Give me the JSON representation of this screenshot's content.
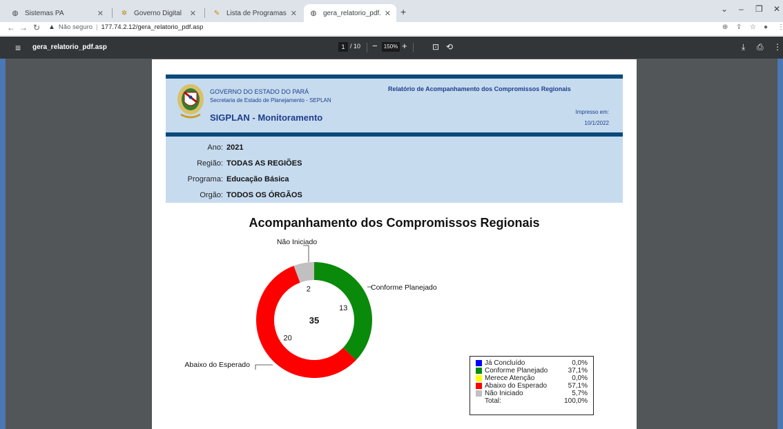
{
  "browser": {
    "tabs": [
      {
        "label": "Sistemas PA",
        "icon": "globe-icon",
        "active": false
      },
      {
        "label": "Governo Digital",
        "icon": "governo-icon",
        "active": false
      },
      {
        "label": "Lista de Programas",
        "icon": "lista-icon",
        "active": false
      },
      {
        "label": "gera_relatorio_pdf.asp",
        "icon": "globe-icon",
        "active": true
      }
    ],
    "new_tab": "+",
    "security_label": "Não seguro",
    "url": "177.74.2.12/gera_relatorio_pdf.asp"
  },
  "pdf_viewer": {
    "file_name": "gera_relatorio_pdf.asp",
    "current_page": "1",
    "page_total": "/ 10",
    "zoom": "150%"
  },
  "report": {
    "government": "GOVERNO DO ESTADO DO PARÁ",
    "secretariat": "Secretaria de Estado de Planejamento - SEPLAN",
    "system": "SIGPLAN - Monitoramento",
    "report_title": "Relatório de Acompanhamento dos Compromissos Regionais",
    "printed_label": "Impresso em:",
    "printed_date": "10/1/2022",
    "params": [
      {
        "label": "Ano:",
        "value": "2021"
      },
      {
        "label": "Região:",
        "value": "TODAS AS REGIÕES"
      },
      {
        "label": "Programa:",
        "value": "Educação Básica"
      },
      {
        "label": "Orgão:",
        "value": "TODOS OS ÓRGÃOS"
      }
    ]
  },
  "chart_data": {
    "type": "pie",
    "title": "Acompanhamento dos Compromissos Regionais",
    "total": 35,
    "slices": [
      {
        "name": "Conforme Planejado",
        "value": 13,
        "color": "#0a8a0a"
      },
      {
        "name": "Abaixo do Esperado",
        "value": 20,
        "color": "#ff0000"
      },
      {
        "name": "Não Iniciado",
        "value": 2,
        "color": "#c0c0c0"
      }
    ],
    "legend": [
      {
        "name": "Já Concluído",
        "percent": "0,0%",
        "color": "#0000ff"
      },
      {
        "name": "Conforme Planejado",
        "percent": "37,1%",
        "color": "#0a8a0a"
      },
      {
        "name": "Merece Atenção",
        "percent": "0,0%",
        "color": "#ffff00"
      },
      {
        "name": "Abaixo do Esperado",
        "percent": "57,1%",
        "color": "#ff0000"
      },
      {
        "name": "Não Iniciado",
        "percent": "5,7%",
        "color": "#c0c0c0"
      }
    ],
    "legend_total_label": "Total:",
    "legend_total_value": "100,0%"
  }
}
